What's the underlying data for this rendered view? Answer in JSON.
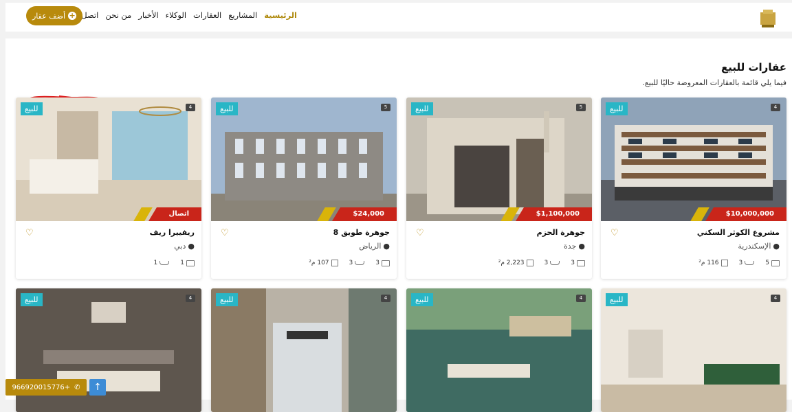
{
  "nav": {
    "links": [
      "الرئيسية",
      "المشاريع",
      "العقارات",
      "الوكلاء",
      "الأخبار",
      "من نحن",
      "اتصل بنا"
    ],
    "add_button": "أضف عقار"
  },
  "section": {
    "title": "عقارات للبيع",
    "subtitle": "فيما يلي قائمة بالعقارات المعروضة حاليًا للبيع."
  },
  "cards": [
    {
      "name": "مشروع الكوثر السكني",
      "location": "الإسكندرية",
      "price": "$10,000,000",
      "badge": "للبيع",
      "beds": "5",
      "baths": "3",
      "area": "116 م²",
      "photos": "4"
    },
    {
      "name": "جوهرة الحزم",
      "location": "جدة",
      "price": "$1,100,000",
      "badge": "للبيع",
      "beds": "3",
      "baths": "3",
      "area": "2,223 م²",
      "photos": "5"
    },
    {
      "name": "جوهرة طويق 8",
      "location": "الرياض",
      "price": "$24,000",
      "badge": "للبيع",
      "beds": "3",
      "baths": "3",
      "area": "107 م²",
      "photos": "5"
    },
    {
      "name": "ريفييرا ريف",
      "location": "دبي",
      "price": "اتصال",
      "badge": "للبيع",
      "beds": "1",
      "baths": "1",
      "area": "",
      "photos": "4"
    }
  ],
  "cards_row2": [
    {
      "badge": "للبيع",
      "photos": "4"
    },
    {
      "badge": "للبيع",
      "photos": "4"
    },
    {
      "badge": "للبيع",
      "photos": "4"
    },
    {
      "badge": "للبيع",
      "photos": "4"
    }
  ],
  "phone": "966920015776+",
  "colors": {
    "accent": "#b88a0c",
    "badge": "#29b6c6",
    "price": "#c9251a"
  }
}
